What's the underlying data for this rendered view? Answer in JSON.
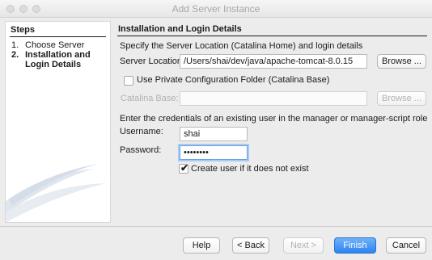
{
  "window": {
    "title": "Add Server Instance"
  },
  "steps": {
    "heading": "Steps",
    "items": [
      {
        "number": "1.",
        "label": "Choose Server"
      },
      {
        "number": "2.",
        "label": "Installation and Login Details"
      }
    ]
  },
  "main": {
    "heading": "Installation and Login Details",
    "location_intro": "Specify the Server Location (Catalina Home) and login details",
    "server_location_label": "Server Location:",
    "server_location_value": "/Users/shai/dev/java/apache-tomcat-8.0.15",
    "browse_label": "Browse ...",
    "private_config_label": "Use Private Configuration Folder (Catalina Base)",
    "private_config_checked": false,
    "catalina_base_label": "Catalina Base:",
    "catalina_base_value": "",
    "credentials_intro": "Enter the credentials of an existing user in the manager or manager-script role",
    "username_label": "Username:",
    "username_value": "shai",
    "password_label": "Password:",
    "password_value": "••••••••",
    "create_user_label": "Create user if it does not exist",
    "create_user_checked": true
  },
  "buttons": {
    "help": "Help",
    "back": "< Back",
    "next": "Next >",
    "finish": "Finish",
    "cancel": "Cancel"
  }
}
